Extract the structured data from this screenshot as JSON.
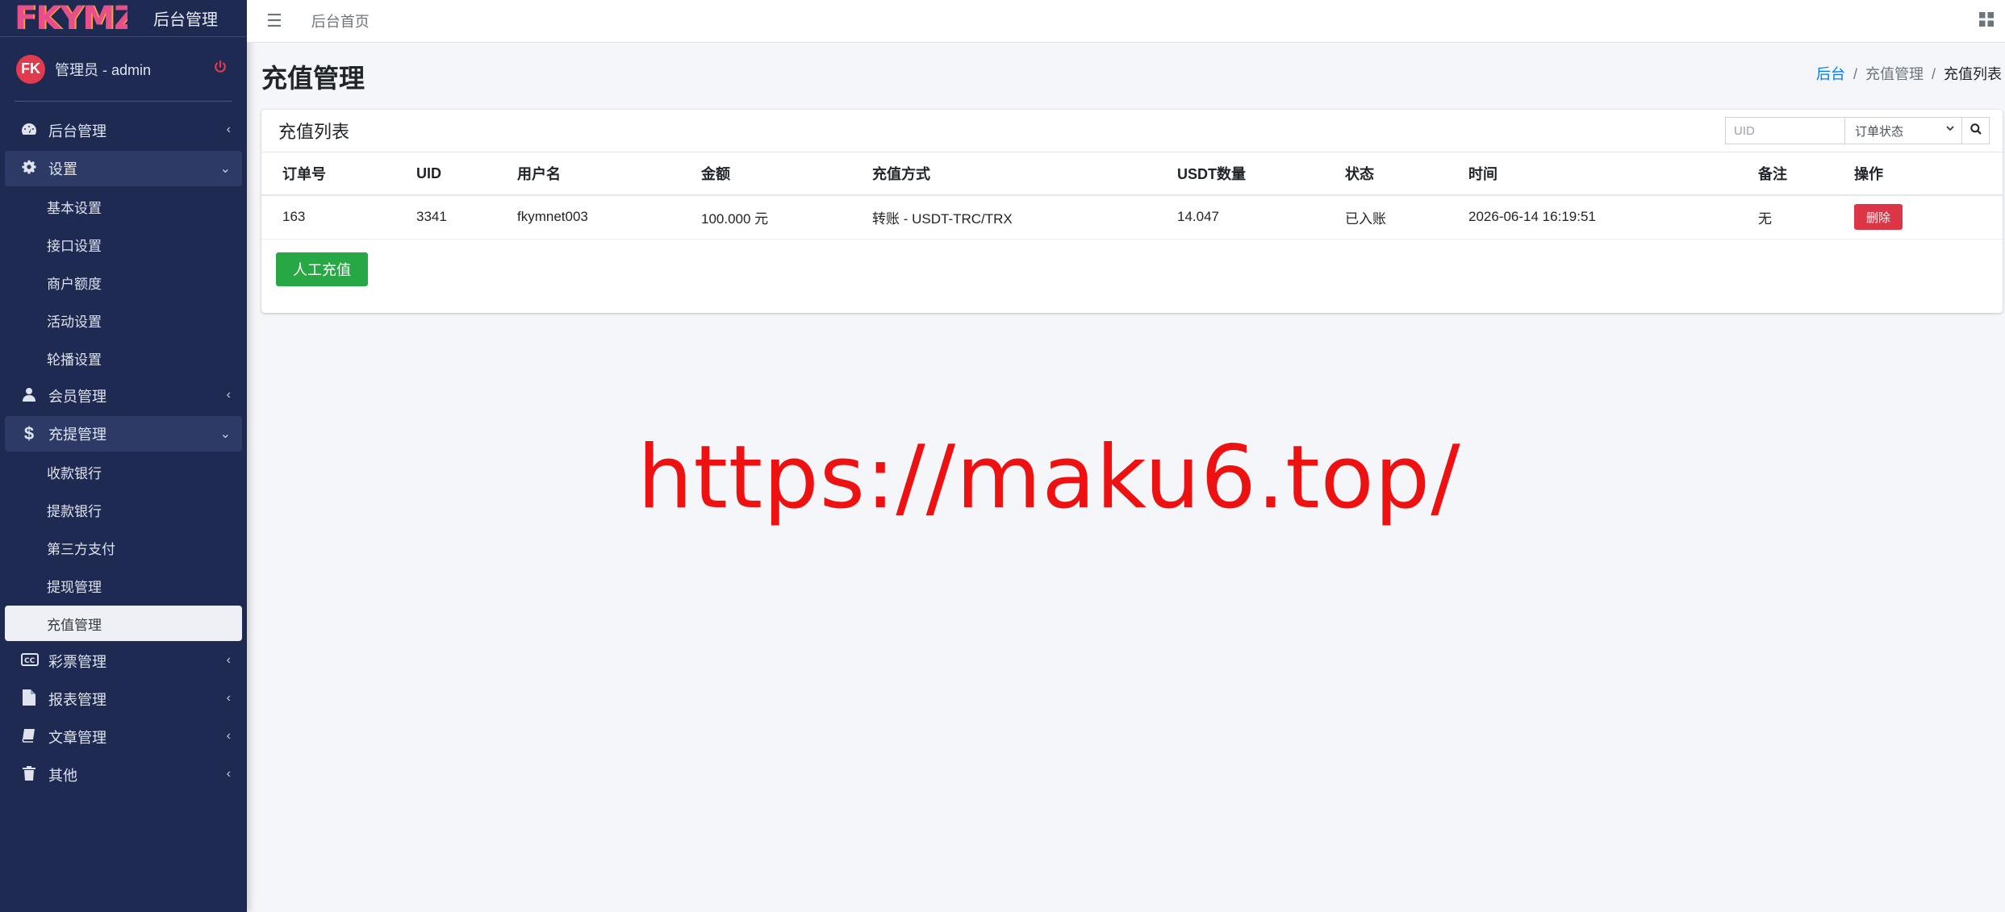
{
  "brand": {
    "logo_text": "FKYMZ",
    "title": "后台管理"
  },
  "user": {
    "avatar_text": "FK",
    "name": "管理员 - admin"
  },
  "nav": [
    {
      "label": "后台管理",
      "icon": "dashboard-icon",
      "type": "group",
      "open": false
    },
    {
      "label": "设置",
      "icon": "gear-icon",
      "type": "group",
      "open": true
    },
    {
      "label": "基本设置",
      "type": "sub"
    },
    {
      "label": "接口设置",
      "type": "sub"
    },
    {
      "label": "商户额度",
      "type": "sub"
    },
    {
      "label": "活动设置",
      "type": "sub"
    },
    {
      "label": "轮播设置",
      "type": "sub"
    },
    {
      "label": "会员管理",
      "icon": "user-icon",
      "type": "group",
      "open": false
    },
    {
      "label": "充提管理",
      "icon": "dollar-icon",
      "type": "group",
      "open": true
    },
    {
      "label": "收款银行",
      "type": "sub"
    },
    {
      "label": "提款银行",
      "type": "sub"
    },
    {
      "label": "第三方支付",
      "type": "sub"
    },
    {
      "label": "提现管理",
      "type": "sub"
    },
    {
      "label": "充值管理",
      "type": "sub",
      "active": true
    },
    {
      "label": "彩票管理",
      "icon": "cc-icon",
      "type": "group",
      "open": false
    },
    {
      "label": "报表管理",
      "icon": "file-icon",
      "type": "group",
      "open": false
    },
    {
      "label": "文章管理",
      "icon": "book-icon",
      "type": "group",
      "open": false
    },
    {
      "label": "其他",
      "icon": "trash-icon",
      "type": "group",
      "open": false
    }
  ],
  "topbar": {
    "home_link": "后台首页"
  },
  "page": {
    "title": "充值管理"
  },
  "breadcrumb": {
    "root": "后台",
    "parent": "充值管理",
    "current": "充值列表"
  },
  "card": {
    "title": "充值列表",
    "uid_placeholder": "UID",
    "status_select": "订单状态",
    "manual_button": "人工充值"
  },
  "table": {
    "columns": [
      "订单号",
      "UID",
      "用户名",
      "金额",
      "充值方式",
      "USDT数量",
      "状态",
      "时间",
      "备注",
      "操作"
    ],
    "rows": [
      {
        "order_no": "163",
        "uid": "3341",
        "username": "fkymnet003",
        "amount": "100.000 元",
        "method": "转账 - USDT-TRC/TRX",
        "usdt": "14.047",
        "status": "已入账",
        "time": "2026-06-14 16:19:51",
        "remark": "无",
        "action": "删除"
      }
    ]
  },
  "watermark": "https://maku6.top/",
  "colors": {
    "sidebar": "#1f2a52",
    "accent_green": "#28a745",
    "danger": "#dc3545",
    "link": "#007bff",
    "watermark": "#ee1111"
  }
}
